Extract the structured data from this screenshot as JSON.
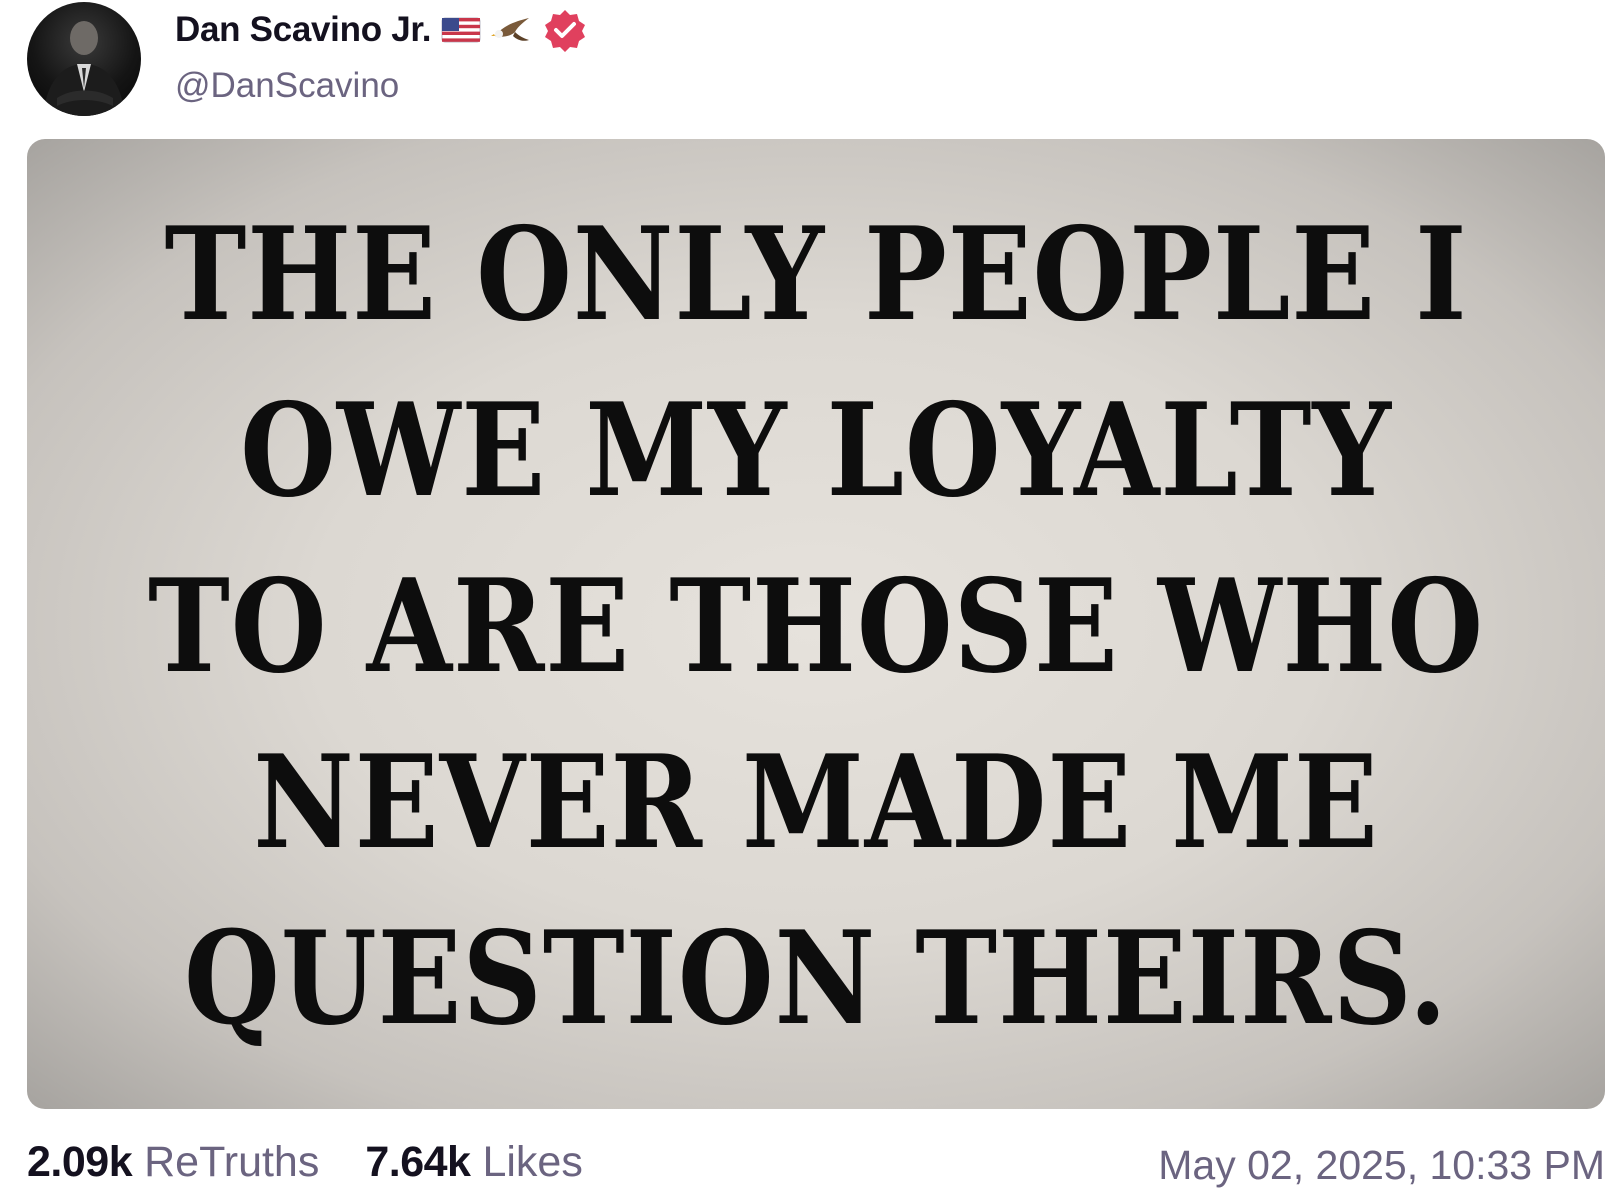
{
  "post": {
    "author": {
      "display_name": "Dan Scavino Jr.",
      "handle": "@DanScavino",
      "name_emojis": [
        "us-flag-icon",
        "eagle-icon"
      ],
      "verified": true,
      "verified_color": "#e0405e"
    },
    "media": {
      "lines": [
        "THE ONLY PEOPLE I",
        "OWE MY LOYALTY",
        "TO ARE THOSE WHO",
        "NEVER MADE ME",
        "QUESTION THEIRS."
      ]
    },
    "stats": {
      "retruths_count": "2.09k",
      "retruths_label": "ReTruths",
      "likes_count": "7.64k",
      "likes_label": "Likes"
    },
    "timestamp": "May 02, 2025, 10:33 PM"
  }
}
